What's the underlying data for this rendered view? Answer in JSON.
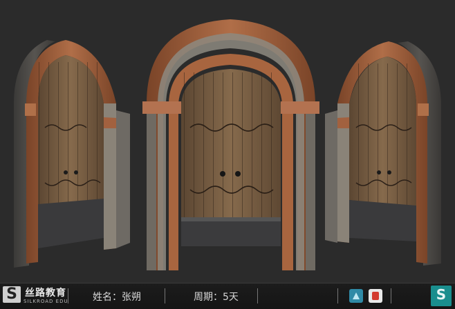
{
  "footer": {
    "brand_cn": "丝路教育",
    "brand_en": "SILKROAD EDU",
    "name_label": "姓名：",
    "name_value": "张朔",
    "period_label": "周期：",
    "period_value": "5天"
  },
  "icons": {
    "tool_a": "3d-app-icon",
    "tool_b": "substance-app-icon",
    "corner": "silkroad-logo-icon"
  },
  "colors": {
    "background": "#2b2b2b",
    "stone": "#4a4845",
    "terracotta": "#a5623f",
    "wood": "#7d6246"
  }
}
